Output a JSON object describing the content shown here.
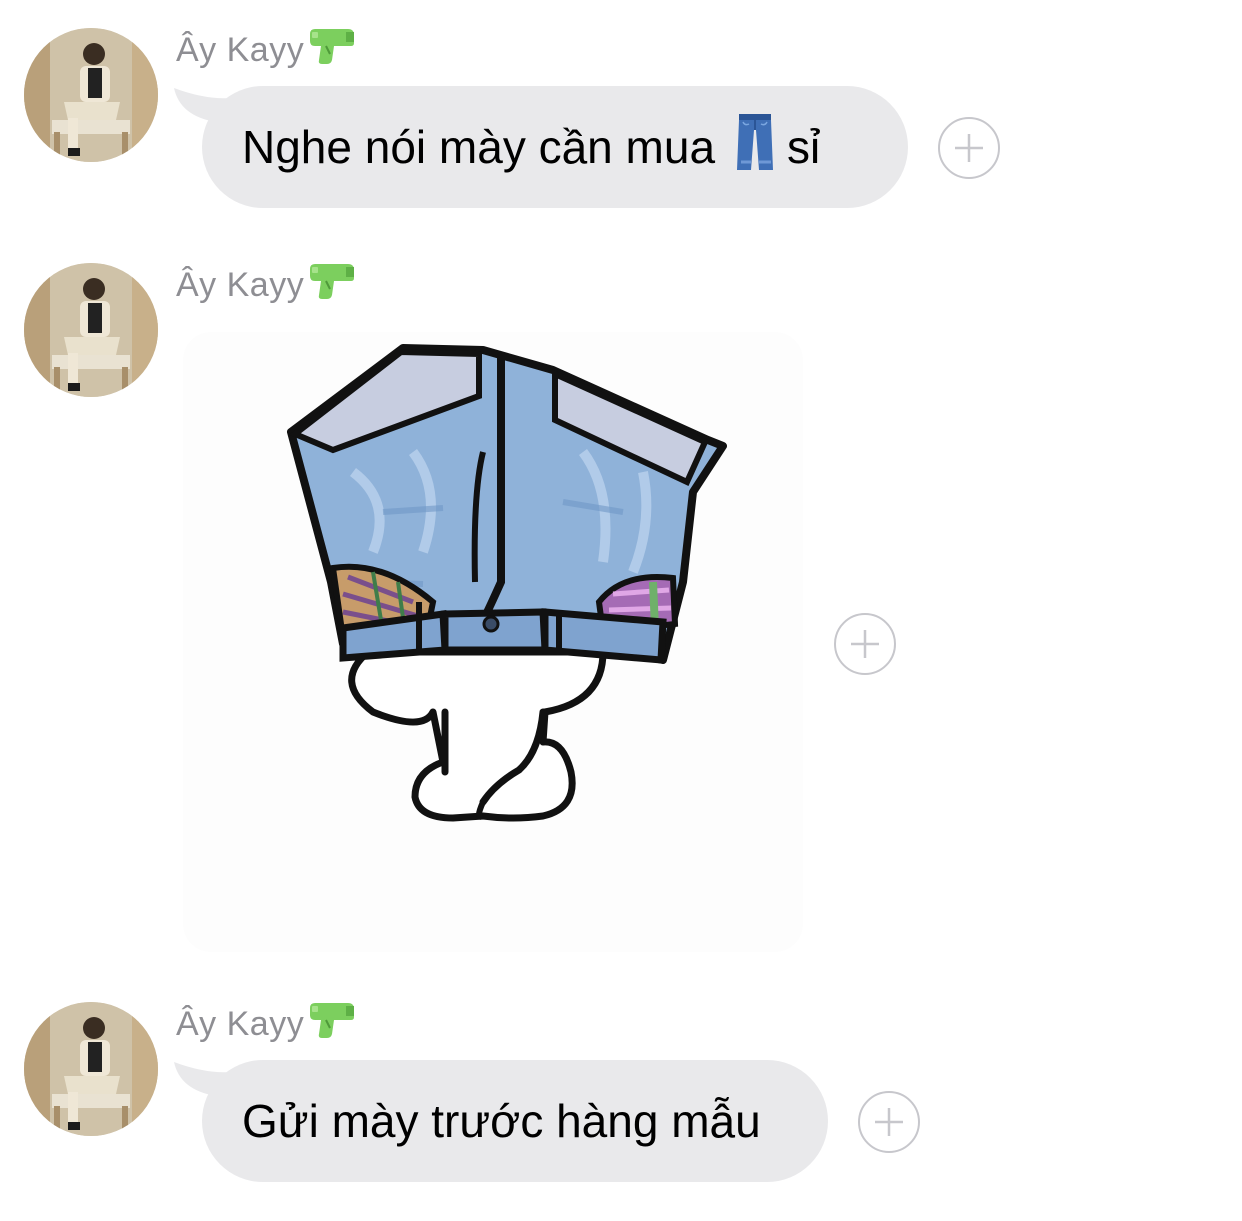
{
  "messages": [
    {
      "sender": "Ây Kayy",
      "sender_emoji": "water-pistol-icon",
      "type": "text",
      "text_before": "Nghe nói mày cần mua",
      "inline_emoji": "jeans-icon",
      "text_after": "sỉ"
    },
    {
      "sender": "Ây Kayy",
      "sender_emoji": "water-pistol-icon",
      "type": "image",
      "image": "jeans-sticker"
    },
    {
      "sender": "Ây Kayy",
      "sender_emoji": "water-pistol-icon",
      "type": "text",
      "text": "Gửi mày trước hàng mẫu"
    }
  ],
  "colors": {
    "bubble": "#e9e9eb",
    "sender": "#8e8e93",
    "add_button": "#c7c7cc",
    "text": "#000000"
  }
}
